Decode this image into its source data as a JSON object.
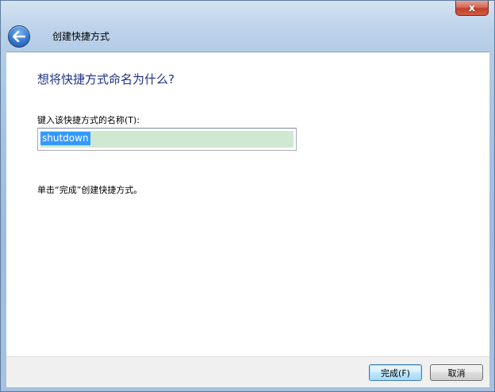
{
  "titlebar": {
    "title": "创建快捷方式",
    "close_glyph": "x"
  },
  "main": {
    "heading": "想将快捷方式命名为什么?",
    "name_label": "键入该快捷方式的名称(T):",
    "name_value": "shutdown",
    "hint": "单击“完成”创建快捷方式。"
  },
  "footer": {
    "finish_label": "完成(F)",
    "cancel_label": "取消"
  },
  "icons": {
    "back": "back-arrow-icon",
    "close": "close-icon"
  },
  "colors": {
    "heading": "#1e3287",
    "selection": "#3399ff",
    "input_fill": "#cfe8d2",
    "close": "#c0402a"
  }
}
